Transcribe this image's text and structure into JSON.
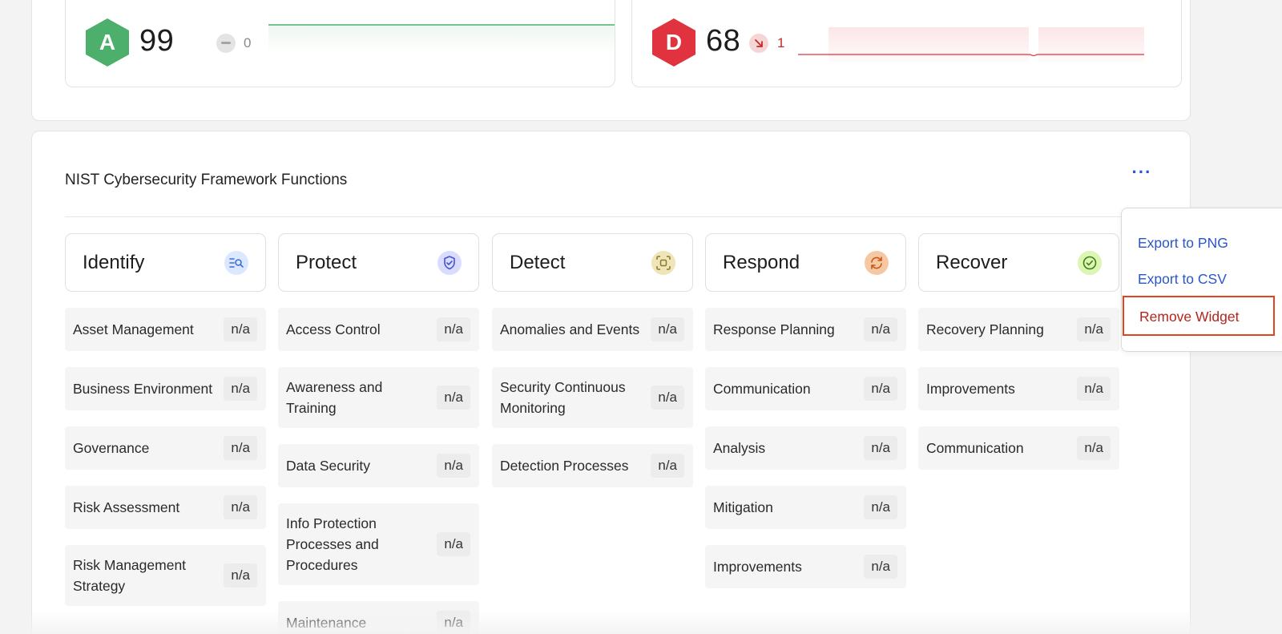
{
  "score_cards": [
    {
      "grade": "A",
      "score": "99",
      "delta": "0",
      "grade_color": "#4caf6b",
      "trend": "neutral"
    },
    {
      "grade": "D",
      "score": "68",
      "delta": "1",
      "grade_color": "#e0323f",
      "trend": "down"
    }
  ],
  "nist": {
    "title": "NIST Cybersecurity Framework Functions",
    "more_icon": "more-horizontal-icon",
    "columns": [
      {
        "label": "Identify",
        "icon": "list-search-icon",
        "icon_bg": "#dbe8ff",
        "icon_color": "#3d6fd6",
        "items": [
          {
            "label": "Asset Management",
            "value": "n/a"
          },
          {
            "label": "Business Environment",
            "value": "n/a"
          },
          {
            "label": "Governance",
            "value": "n/a"
          },
          {
            "label": "Risk Assessment",
            "value": "n/a"
          },
          {
            "label": "Risk Management Strategy",
            "value": "n/a"
          }
        ]
      },
      {
        "label": "Protect",
        "icon": "shield-check-icon",
        "icon_bg": "#d9dcff",
        "icon_color": "#4a51c9",
        "items": [
          {
            "label": "Access Control",
            "value": "n/a"
          },
          {
            "label": "Awareness and Training",
            "value": "n/a"
          },
          {
            "label": "Data Security",
            "value": "n/a"
          },
          {
            "label": "Info Protection Processes and Procedures",
            "value": "n/a"
          },
          {
            "label": "Maintenance",
            "value": "n/a"
          }
        ]
      },
      {
        "label": "Detect",
        "icon": "scan-icon",
        "icon_bg": "#efe5b8",
        "icon_color": "#8a7a2e",
        "items": [
          {
            "label": "Anomalies and Events",
            "value": "n/a"
          },
          {
            "label": "Security Continuous Monitoring",
            "value": "n/a"
          },
          {
            "label": "Detection Processes",
            "value": "n/a"
          }
        ]
      },
      {
        "label": "Respond",
        "icon": "refresh-icon",
        "icon_bg": "#f6c7a3",
        "icon_color": "#c35a17",
        "items": [
          {
            "label": "Response Planning",
            "value": "n/a"
          },
          {
            "label": "Communication",
            "value": "n/a"
          },
          {
            "label": "Analysis",
            "value": "n/a"
          },
          {
            "label": "Mitigation",
            "value": "n/a"
          },
          {
            "label": "Improvements",
            "value": "n/a"
          }
        ]
      },
      {
        "label": "Recover",
        "icon": "check-circle-icon",
        "icon_bg": "#dcf5b0",
        "icon_color": "#3f7d1b",
        "items": [
          {
            "label": "Recovery Planning",
            "value": "n/a"
          },
          {
            "label": "Improvements",
            "value": "n/a"
          },
          {
            "label": "Communication",
            "value": "n/a"
          }
        ]
      }
    ]
  },
  "menu": {
    "export_png": "Export to PNG",
    "export_csv": "Export to CSV",
    "remove_widget": "Remove Widget"
  }
}
